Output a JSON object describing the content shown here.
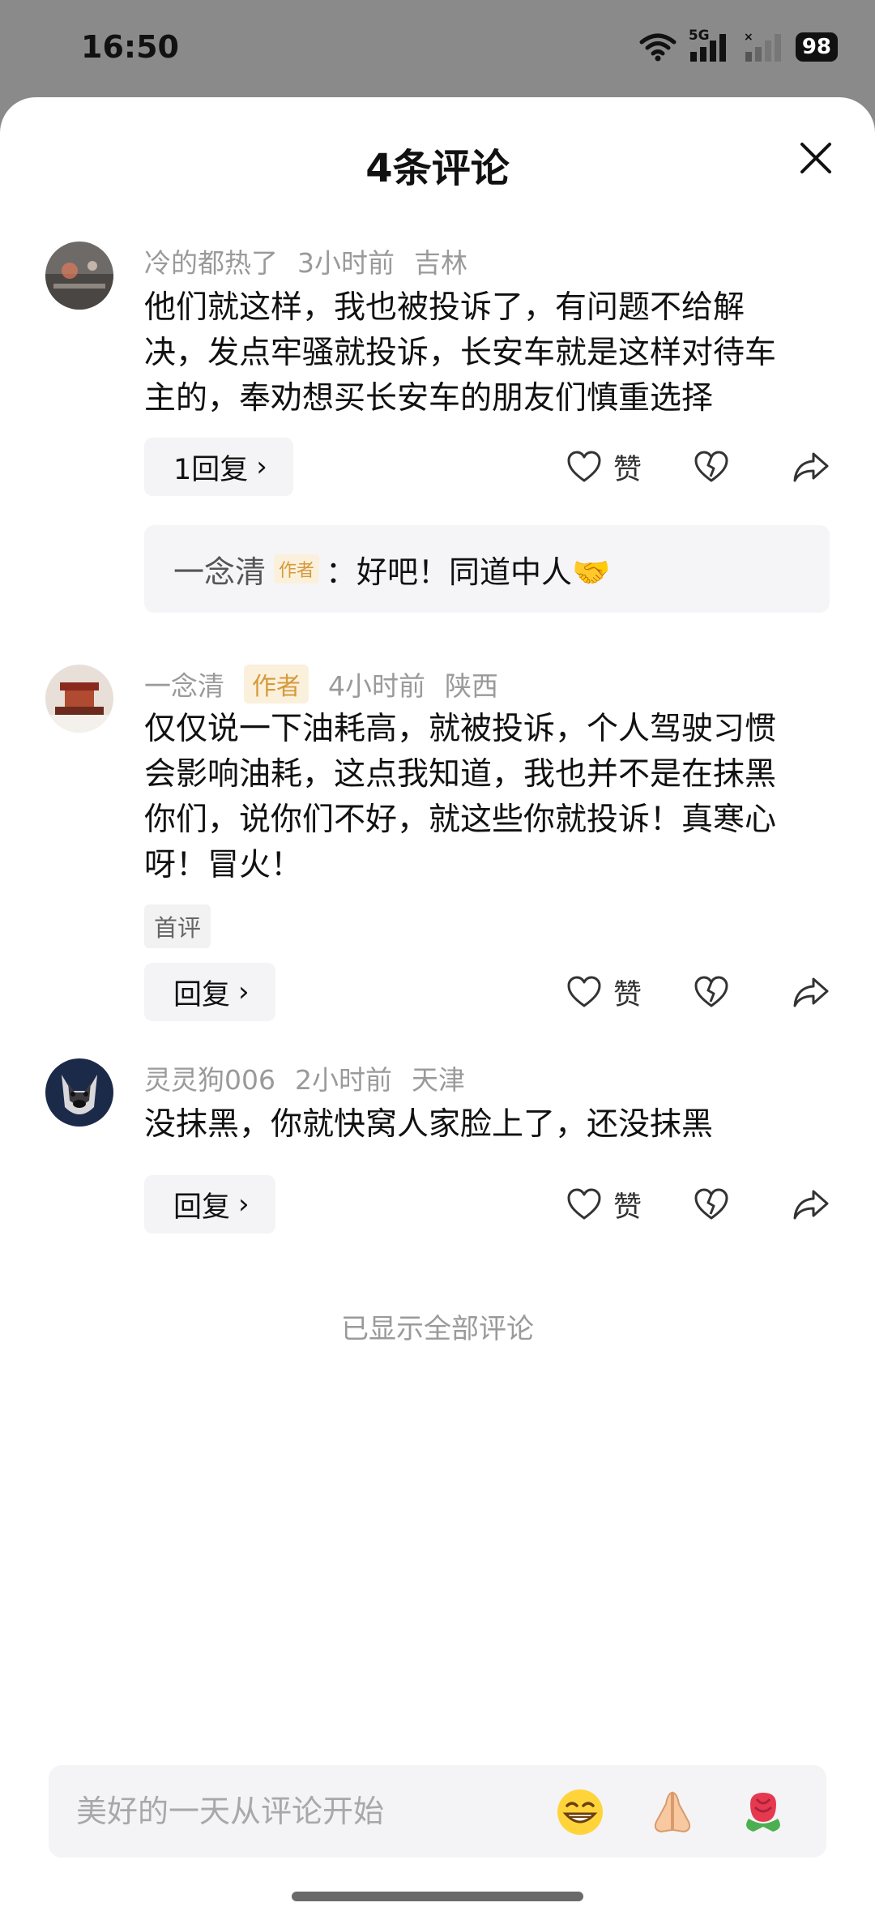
{
  "status_bar": {
    "time": "16:50",
    "network": "5G",
    "battery": "98"
  },
  "sheet": {
    "title": "4条评论"
  },
  "comments": [
    {
      "user": "冷的都热了",
      "time": "3小时前",
      "location": "吉林",
      "lines": [
        "他们就这样，我也被投诉了，有问题不给解",
        "决，发点牢骚就投诉，长安车就是这样对待车",
        "主的，奉劝想买长安车的朋友们慎重选择"
      ],
      "reply_label": "1回复",
      "like_label": "赞",
      "sub_reply": {
        "user": "一念清",
        "tag": "作者",
        "text": "：好吧！同道中人🤝"
      }
    },
    {
      "user": "一念清",
      "author_tag": "作者",
      "time": "4小时前",
      "location": "陕西",
      "lines": [
        "仅仅说一下油耗高，就被投诉，个人驾驶习惯",
        "会影响油耗，这点我知道，我也并不是在抹黑",
        "你们，说你们不好，就这些你就投诉！真寒心",
        "呀！冒火！"
      ],
      "badge": "首评",
      "reply_label": "回复",
      "like_label": "赞"
    },
    {
      "user": "灵灵狗006",
      "time": "2小时前",
      "location": "天津",
      "lines": [
        "没抹黑，你就快窝人家脸上了，还没抹黑"
      ],
      "reply_label": "回复",
      "like_label": "赞"
    }
  ],
  "footer": {
    "all_shown": "已显示全部评论"
  },
  "input": {
    "placeholder": "美好的一天从评论开始",
    "value": ""
  },
  "emojis": [
    "grin-emoji",
    "pray-emoji",
    "rose-emoji"
  ],
  "colors": {
    "author_tag_bg": "#fbf0dc",
    "author_tag_text": "#d49a3a",
    "muted": "#9a9a9a"
  }
}
